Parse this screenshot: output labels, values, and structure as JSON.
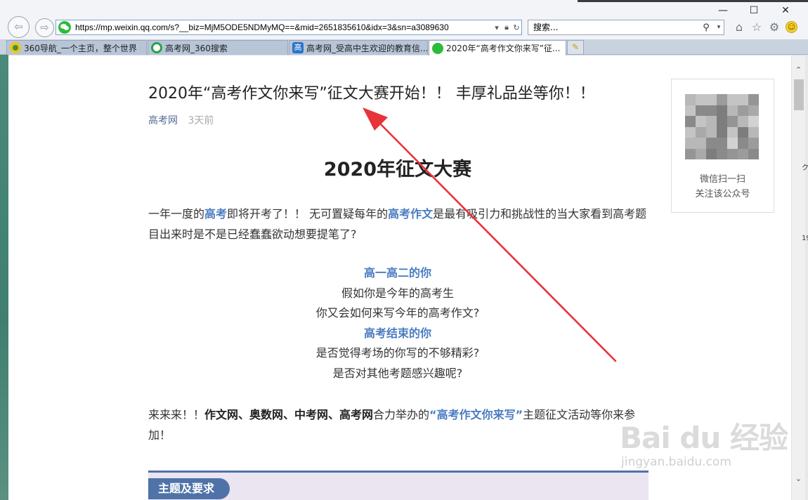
{
  "browser": {
    "address_url": "https://mp.weixin.qq.com/s?__biz=MjM5ODE5NDMyMQ==&mid=2651835610&idx=3&sn=a3089630",
    "search_placeholder": "搜索...",
    "window_controls": {
      "minimize": "—",
      "maximize": "☐",
      "close": "✕"
    },
    "icons": [
      "back-arrow-icon",
      "forward-arrow-icon",
      "wechat-site-icon",
      "lock-icon",
      "refresh-icon",
      "search-icon",
      "home-icon",
      "favorites-star-icon",
      "settings-gear-icon",
      "smiley-feedback-icon"
    ]
  },
  "tabs": [
    {
      "label": "360导航_一个主页，整个世界",
      "icon": "360-icon"
    },
    {
      "label": "高考网_360搜索",
      "icon": "360search-icon"
    },
    {
      "label": "高考网_受高中生欢迎的教育信...",
      "icon": "gaokao-icon",
      "icon_text": "高"
    },
    {
      "label": "2020年“高考作文你来写”征...",
      "icon": "wechat-icon",
      "active": true
    }
  ],
  "article": {
    "title": "2020年“高考作文你来写”征文大赛开始！！ 丰厚礼品坐等你！！",
    "source": "高考网",
    "time": "3天前",
    "heading": "2020年征文大赛",
    "intro": {
      "t1": "一年一度的",
      "h1": "高考",
      "t2": "即将开考了！！ 无可置疑每年的",
      "h2": "高考作文",
      "t3": "是最有吸引力和挑战性的当大家看到高考题目出来时是不是已经蠢蠢欲动想要提笔了?"
    },
    "center_lines": [
      {
        "text": "高一高二的你",
        "highlight": true
      },
      {
        "text": "假如你是今年的高考生",
        "highlight": false
      },
      {
        "text": "你又会如何来写今年的高考作文?",
        "highlight": false
      },
      {
        "text": "高考结束的你",
        "highlight": true
      },
      {
        "text": "是否觉得考场的你写的不够精彩?",
        "highlight": false
      },
      {
        "text": "是否对其他考题感兴趣呢?",
        "highlight": false
      }
    ],
    "closing": {
      "t1": "来来来！！",
      "b1": "作文网、奥数网、中考网、高考网",
      "t2": "合力举办的",
      "h1": "“高考作文你来写”",
      "t3": "主题征文活动等你来参加！"
    },
    "section_label": "主题及要求"
  },
  "qr_panel": {
    "line1": "微信扫一扫",
    "line2": "关注该公众号"
  },
  "watermark": {
    "logo": "Bai du 经验",
    "url": "jingyan.baidu.com"
  },
  "colors": {
    "accent_link": "#576b95",
    "highlight_blue": "#4a7cc1",
    "section_blue": "#4f73a8",
    "section_bg": "#ebe4f1",
    "annotation_red": "#e8333a"
  },
  "edge_fragments": [
    "ク",
    "19"
  ]
}
